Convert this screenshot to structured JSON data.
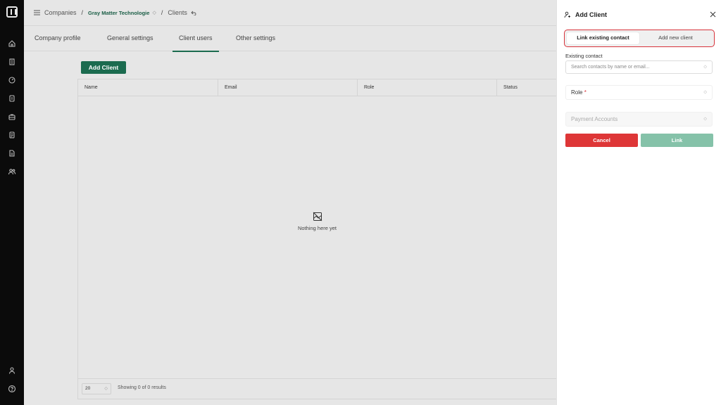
{
  "breadcrumb": {
    "root": "Companies",
    "company": "Gray Matter Technologie",
    "current": "Clients"
  },
  "tabs": [
    {
      "label": "Company profile"
    },
    {
      "label": "General settings"
    },
    {
      "label": "Client users",
      "active": true
    },
    {
      "label": "Other settings"
    }
  ],
  "toolbar": {
    "add_label": "Add Client"
  },
  "table": {
    "columns": [
      "Name",
      "Email",
      "Role",
      "Status"
    ],
    "rows": [],
    "empty_text": "Nothing here yet"
  },
  "pagination": {
    "per_page": "20",
    "showing": "Showing 0 of 0 results"
  },
  "panel": {
    "title": "Add Client",
    "segments": [
      "Link existing contact",
      "Add new client"
    ],
    "active_segment": "Link existing contact",
    "existing_label": "Existing contact",
    "search_placeholder": "Search contacts by name or email...",
    "role_label": "Role",
    "role_required": "*",
    "payment_label": "Payment Accounts",
    "cancel_label": "Cancel",
    "link_label": "Link"
  },
  "colors": {
    "brand": "#1b6b4f",
    "danger": "#de3637",
    "link_disabled": "#85c2a9"
  }
}
